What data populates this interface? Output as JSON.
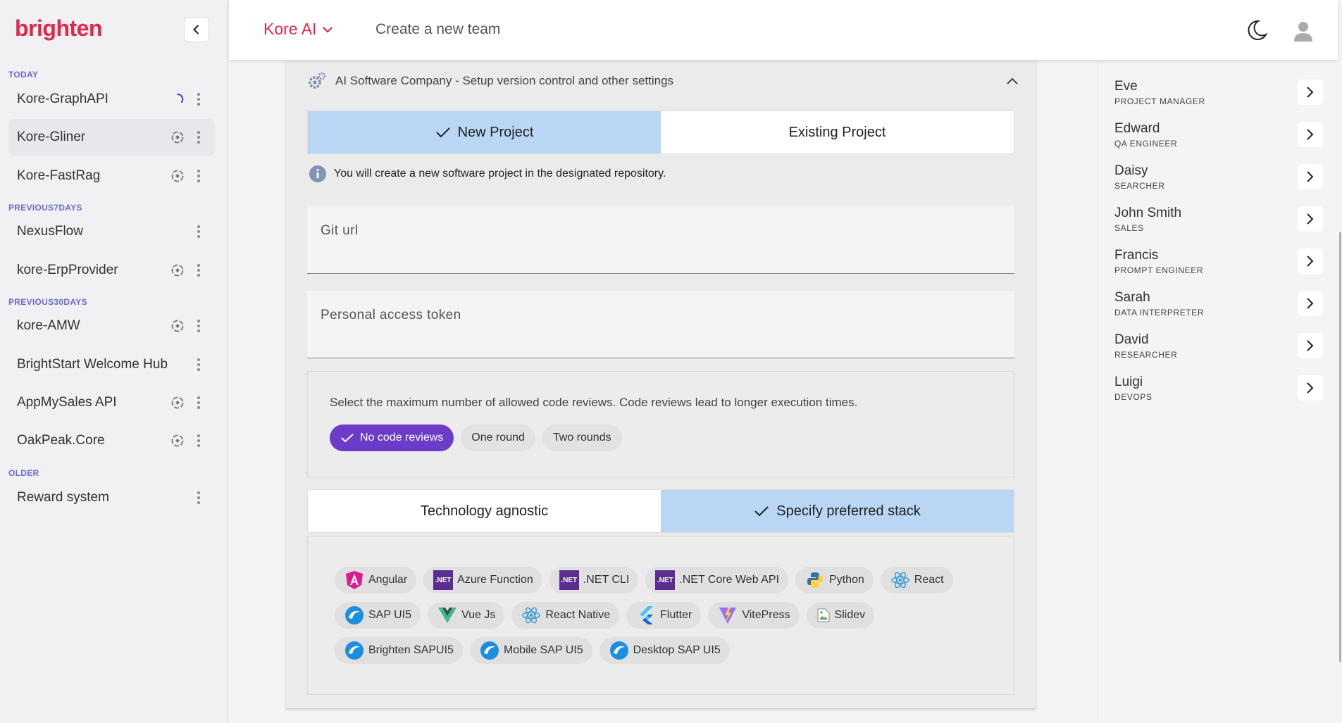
{
  "sidebar": {
    "brand": "brighten",
    "sections": [
      {
        "label": "TODAY"
      },
      {
        "label": "PREVIOUS7DAYS"
      },
      {
        "label": "PREVIOUS30DAYS"
      },
      {
        "label": "OLDER"
      }
    ],
    "items": [
      {
        "label": "Kore-GraphAPI",
        "status": "loading"
      },
      {
        "label": "Kore-Gliner",
        "status": "synced"
      },
      {
        "label": "Kore-FastRag",
        "status": "synced"
      },
      {
        "label": "NexusFlow",
        "status": "none"
      },
      {
        "label": "kore-ErpProvider",
        "status": "synced"
      },
      {
        "label": "kore-AMW",
        "status": "synced"
      },
      {
        "label": "BrightStart Welcome Hub",
        "status": "none"
      },
      {
        "label": "AppMySales API",
        "status": "synced"
      },
      {
        "label": "OakPeak.Core",
        "status": "synced"
      },
      {
        "label": "Reward system",
        "status": "none"
      }
    ]
  },
  "header": {
    "org": "Kore AI",
    "title": "Create a new team"
  },
  "card": {
    "title": "AI Software Company - Setup version control and other settings",
    "project_toggle": {
      "new": "New Project",
      "existing": "Existing Project",
      "selected": "new"
    },
    "info": "You will create a new software project in the designated repository.",
    "git_url_placeholder": "Git url",
    "token_placeholder": "Personal access token",
    "reviews": {
      "description": "Select the maximum number of allowed code reviews. Code reviews lead to longer execution times.",
      "options": [
        "No code reviews",
        "One round",
        "Two rounds"
      ],
      "selected": "No code reviews"
    },
    "stack_toggle": {
      "agnostic": "Technology agnostic",
      "preferred": "Specify preferred stack",
      "selected": "preferred"
    },
    "technologies": [
      {
        "label": "Angular",
        "icon": "angular-icon"
      },
      {
        "label": "Azure Function",
        "icon": "dotnet-icon"
      },
      {
        "label": ".NET CLI",
        "icon": "dotnet-icon"
      },
      {
        "label": ".NET Core Web API",
        "icon": "dotnet-icon"
      },
      {
        "label": "Python",
        "icon": "python-icon"
      },
      {
        "label": "React",
        "icon": "react-icon"
      },
      {
        "label": "SAP UI5",
        "icon": "sap-ui5-icon"
      },
      {
        "label": "Vue Js",
        "icon": "vue-icon"
      },
      {
        "label": "React Native",
        "icon": "react-icon"
      },
      {
        "label": "Flutter",
        "icon": "flutter-icon"
      },
      {
        "label": "VitePress",
        "icon": "vitepress-icon"
      },
      {
        "label": "Slidev",
        "icon": "broken-image-icon"
      },
      {
        "label": "Brighten SAPUI5",
        "icon": "sap-ui5-icon"
      },
      {
        "label": "Mobile SAP UI5",
        "icon": "sap-ui5-icon"
      },
      {
        "label": "Desktop SAP UI5",
        "icon": "sap-ui5-icon"
      }
    ],
    "dotnet_badge": ".NET"
  },
  "team": [
    {
      "name": "Eve",
      "role": "PROJECT MANAGER"
    },
    {
      "name": "Edward",
      "role": "QA ENGINEER"
    },
    {
      "name": "Daisy",
      "role": "SEARCHER"
    },
    {
      "name": "John Smith",
      "role": "SALES"
    },
    {
      "name": "Francis",
      "role": "PROMPT ENGINEER"
    },
    {
      "name": "Sarah",
      "role": "DATA INTERPRETER"
    },
    {
      "name": "David",
      "role": "RESEARCHER"
    },
    {
      "name": "Luigi",
      "role": "DEVOPS"
    }
  ],
  "colors": {
    "brand": "#e0284a",
    "accent_purple": "#6c3bc9",
    "selected_blue": "#b9d6f5"
  }
}
